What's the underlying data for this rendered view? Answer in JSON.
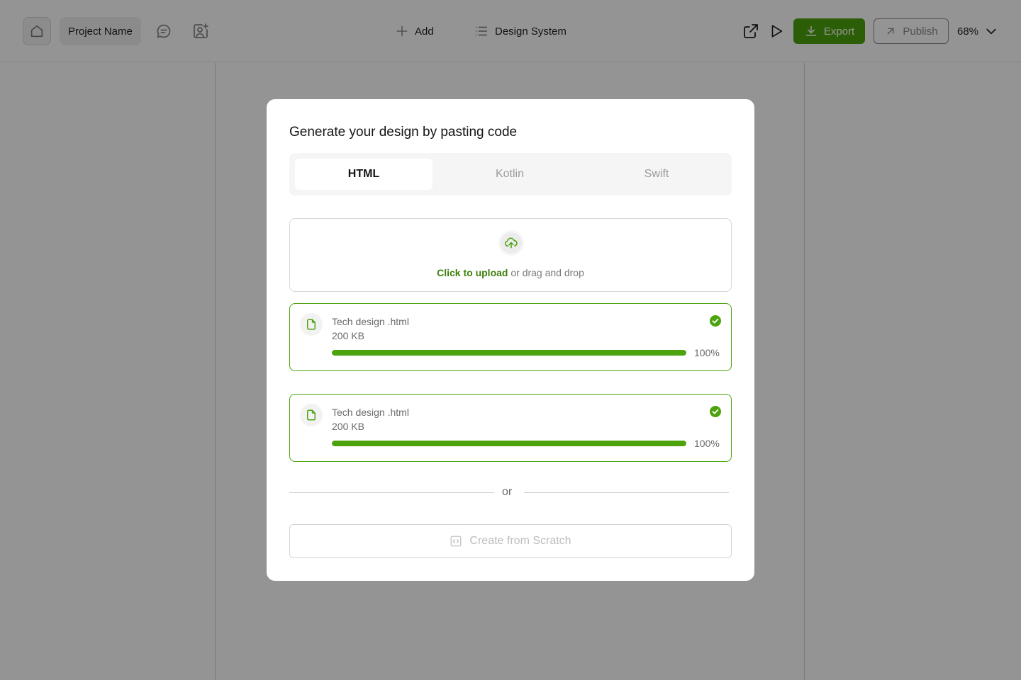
{
  "toolbar": {
    "project_name": "Project Name",
    "add_label": "Add",
    "design_system_label": "Design System",
    "export_label": "Export",
    "publish_label": "Publish",
    "zoom_level": "68%",
    "icons": [
      "home-icon",
      "comment-icon",
      "add-user-icon",
      "plus-icon",
      "list-icon",
      "external-link-icon",
      "play-icon",
      "download-icon",
      "arrow-up-right-icon",
      "chevron-down-icon"
    ]
  },
  "modal": {
    "title": "Generate your design by pasting code",
    "tabs": [
      {
        "label": "HTML",
        "active": true
      },
      {
        "label": "Kotlin",
        "active": false
      },
      {
        "label": "Swift",
        "active": false
      }
    ],
    "upload": {
      "link_text": "Click to upload",
      "rest_text": " or drag and drop",
      "icon": "upload-cloud-icon"
    },
    "files": [
      {
        "name": "Tech design .html",
        "size": "200 KB",
        "progress": 100,
        "progress_label": "100%",
        "status": "complete"
      },
      {
        "name": "Tech design .html",
        "size": "200 KB",
        "progress": 100,
        "progress_label": "100%",
        "status": "complete"
      }
    ],
    "divider_text": "or",
    "scratch_label": "Create from Scratch"
  },
  "colors": {
    "accent": "#4ca30d",
    "accent_text": "#3d7f0b",
    "overlay": "rgba(0,0,0,0.42)"
  }
}
